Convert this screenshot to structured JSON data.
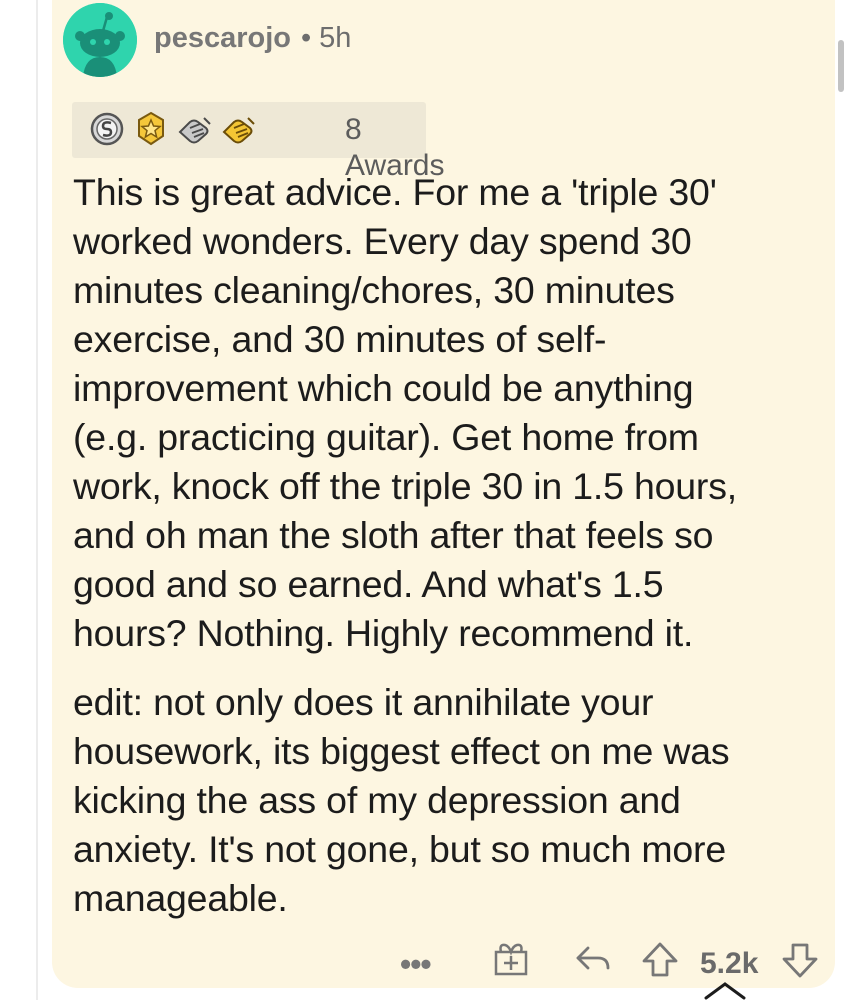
{
  "comment": {
    "username": "pescarojo",
    "separator": "•",
    "time": "5h",
    "awards_label": "8 Awards",
    "award_icons": [
      "silver-award-icon",
      "gold-medal-icon",
      "helping-hand-icon",
      "gold-helping-hand-icon"
    ],
    "paragraphs": [
      "This is great advice. For me a 'triple 30'\nworked wonders.  Every day spend 30\nminutes cleaning/chores, 30 minutes\nexercise, and 30 minutes of self-\nimprovement which could be anything\n(e.g. practicing guitar).  Get home from\nwork, knock off the triple 30 in 1.5 hours,\nand oh man the sloth after that feels so\ngood and so earned. And what's 1.5\nhours? Nothing.  Highly recommend it.",
      "edit:  not only does it annihilate your\nhousework, its biggest effect on me was\nkicking the ass of my depression and\nanxiety.  It's not gone, but so much more\nmanageable."
    ],
    "more_label": "•••",
    "score": "5.2k"
  },
  "colors": {
    "card_background": "#fdf6e1",
    "avatar_background": "#2fd4ad",
    "text": "#1c1c1c",
    "meta_text": "#6d6d6d"
  }
}
